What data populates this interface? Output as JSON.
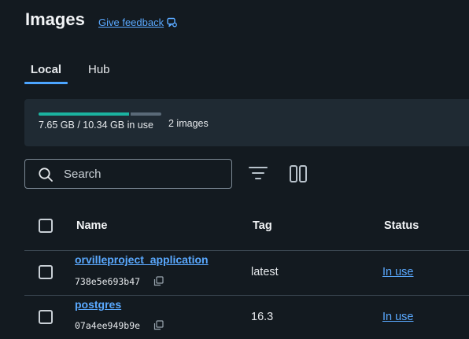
{
  "header": {
    "title": "Images",
    "feedback_label": "Give feedback"
  },
  "tabs": [
    {
      "label": "Local",
      "active": true
    },
    {
      "label": "Hub",
      "active": false
    }
  ],
  "storage": {
    "usage_text": "7.65 GB / 10.34 GB in use",
    "used_fraction": 0.74,
    "count_text": "2 images"
  },
  "search": {
    "placeholder": "Search",
    "value": ""
  },
  "table": {
    "columns": [
      "Name",
      "Tag",
      "Status"
    ],
    "rows": [
      {
        "name": "orvilleproject_application",
        "id": "738e5e693b47",
        "tag": "latest",
        "status": "In use"
      },
      {
        "name": "postgres",
        "id": "07a4ee949b9e",
        "tag": "16.3",
        "status": "In use"
      }
    ]
  },
  "colors": {
    "background": "#131a20",
    "accent": "#4ca5ff",
    "link": "#5aa9ff",
    "usage_bar": "#1bb3a0"
  },
  "icons": {
    "feedback": "feedback-icon",
    "search": "search-icon",
    "filter": "filter-icon",
    "columns": "columns-icon",
    "copy": "copy-icon"
  }
}
